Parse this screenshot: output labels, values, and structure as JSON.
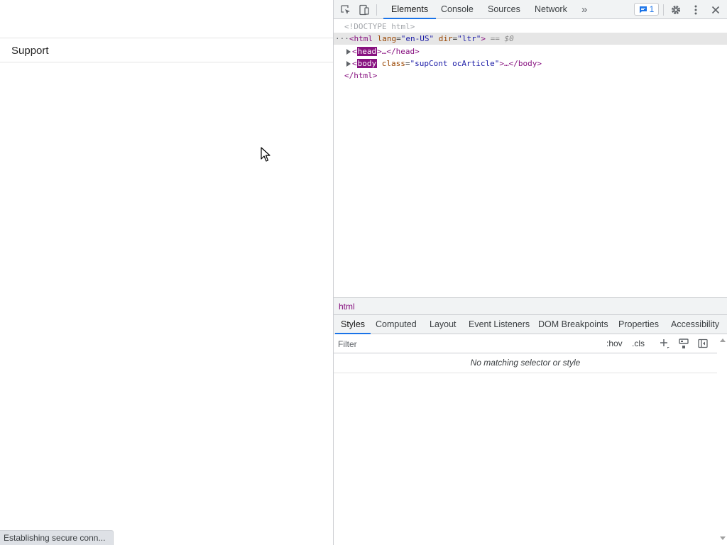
{
  "page": {
    "title": "Support",
    "status_text": "Establishing secure conn..."
  },
  "devtools": {
    "tabs": [
      "Elements",
      "Console",
      "Sources",
      "Network"
    ],
    "more_tabs": "»",
    "issues_count": "1",
    "dom": {
      "doctype": "<!DOCTYPE html>",
      "html_line": {
        "dots": "···",
        "open": "<html",
        "attr1_name": "lang",
        "attr1_value": "\"en-US\"",
        "attr2_name": "dir",
        "attr2_value": "\"ltr\"",
        "close": ">",
        "marker": "== $0"
      },
      "head_line": {
        "tag": "head",
        "rest": ">…</head>"
      },
      "body_line": {
        "tag": "body",
        "attr_name": "class",
        "attr_value": "\"supCont ocArticle\"",
        "rest": ">…</body>"
      },
      "close_html": "</html>"
    },
    "breadcrumb": "html",
    "sub_tabs": [
      "Styles",
      "Computed",
      "Layout",
      "Event Listeners",
      "DOM Breakpoints",
      "Properties",
      "Accessibility"
    ],
    "filter": {
      "placeholder": "Filter",
      "hov": ":hov",
      "cls": ".cls"
    },
    "no_match_text": "No matching selector or style"
  },
  "colors": {
    "accent": "#1a73e8",
    "tag": "#881280",
    "attr_name": "#994500",
    "attr_value": "#1a1aa6"
  }
}
